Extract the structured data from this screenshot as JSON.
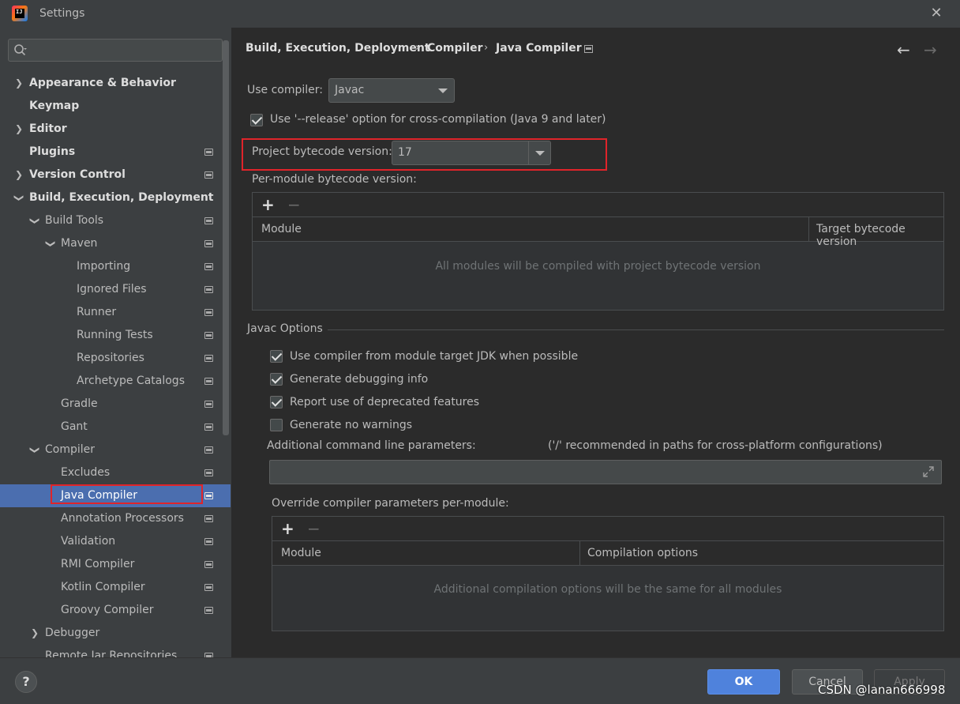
{
  "window": {
    "title": "Settings",
    "close": "✕"
  },
  "search": {
    "placeholder": ""
  },
  "sidebar": {
    "items": [
      {
        "label": "Appearance & Behavior"
      },
      {
        "label": "Keymap"
      },
      {
        "label": "Editor"
      },
      {
        "label": "Plugins"
      },
      {
        "label": "Version Control"
      },
      {
        "label": "Build, Execution, Deployment"
      },
      {
        "label": "Build Tools"
      },
      {
        "label": "Maven"
      },
      {
        "label": "Importing"
      },
      {
        "label": "Ignored Files"
      },
      {
        "label": "Runner"
      },
      {
        "label": "Running Tests"
      },
      {
        "label": "Repositories"
      },
      {
        "label": "Archetype Catalogs"
      },
      {
        "label": "Gradle"
      },
      {
        "label": "Gant"
      },
      {
        "label": "Compiler"
      },
      {
        "label": "Excludes"
      },
      {
        "label": "Java Compiler"
      },
      {
        "label": "Annotation Processors"
      },
      {
        "label": "Validation"
      },
      {
        "label": "RMI Compiler"
      },
      {
        "label": "Kotlin Compiler"
      },
      {
        "label": "Groovy Compiler"
      },
      {
        "label": "Debugger"
      },
      {
        "label": "Remote Jar Repositories"
      }
    ],
    "selected": "Java Compiler"
  },
  "breadcrumb": {
    "items": [
      "Build, Execution, Deployment",
      "Compiler",
      "Java Compiler"
    ],
    "separator": "›"
  },
  "nav": {
    "back": "←",
    "forward": "→"
  },
  "compiler": {
    "use_compiler_label": "Use compiler:",
    "use_compiler_value": "Javac",
    "release_option_label": "Use '--release' option for cross-compilation (Java 9 and later)",
    "release_option_checked": true,
    "project_bytecode_label": "Project bytecode version:",
    "project_bytecode_value": "17",
    "per_module_label": "Per-module bytecode version:",
    "per_module_table": {
      "add": "+",
      "remove": "−",
      "columns": [
        "Module",
        "Target bytecode version"
      ],
      "empty_text": "All modules will be compiled with project bytecode version"
    }
  },
  "javac": {
    "section_title": "Javac Options",
    "options": [
      {
        "label": "Use compiler from module target JDK when possible",
        "checked": true
      },
      {
        "label": "Generate debugging info",
        "checked": true
      },
      {
        "label": "Report use of deprecated features",
        "checked": true
      },
      {
        "label": "Generate no warnings",
        "checked": false
      }
    ],
    "cmdline_label": "Additional command line parameters:",
    "cmdline_hint": "('/' recommended in paths for cross-platform configurations)",
    "cmdline_value": "",
    "override_label": "Override compiler parameters per-module:",
    "override_table": {
      "add": "+",
      "remove": "−",
      "columns": [
        "Module",
        "Compilation options"
      ],
      "empty_text": "Additional compilation options will be the same for all modules"
    }
  },
  "footer": {
    "help": "?",
    "ok": "OK",
    "cancel": "Cancel",
    "apply": "Apply"
  },
  "watermark": "CSDN @lanan666998",
  "colors": {
    "accent": "#4b6eaf",
    "ok_button": "#4f82dc",
    "highlight_box": "#e0242a",
    "background": "#2b2b2b",
    "sidebar": "#3c3f41"
  }
}
